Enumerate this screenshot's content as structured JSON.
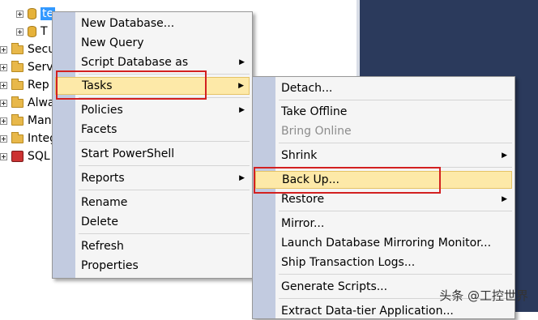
{
  "tree": {
    "nodes": [
      {
        "label": "te",
        "icon": "database-icon"
      },
      {
        "label": "T",
        "icon": "database-icon"
      },
      {
        "label": "Secu",
        "icon": "folder-icon"
      },
      {
        "label": "Serv",
        "icon": "folder-icon"
      },
      {
        "label": "Rep",
        "icon": "folder-icon"
      },
      {
        "label": "Alwa",
        "icon": "folder-icon"
      },
      {
        "label": "Man",
        "icon": "folder-icon"
      },
      {
        "label": "Integ",
        "icon": "folder-icon"
      },
      {
        "label": "SQL",
        "icon": "sql-agent-icon"
      }
    ]
  },
  "context_menu": {
    "items": [
      {
        "label": "New Database..."
      },
      {
        "label": "New Query"
      },
      {
        "label": "Script Database as"
      },
      {
        "label": "Tasks"
      },
      {
        "label": "Policies"
      },
      {
        "label": "Facets"
      },
      {
        "label": "Start PowerShell"
      },
      {
        "label": "Reports"
      },
      {
        "label": "Rename"
      },
      {
        "label": "Delete"
      },
      {
        "label": "Refresh"
      },
      {
        "label": "Properties"
      }
    ]
  },
  "tasks_submenu": {
    "items": [
      {
        "label": "Detach..."
      },
      {
        "label": "Take Offline"
      },
      {
        "label": "Bring Online"
      },
      {
        "label": "Shrink"
      },
      {
        "label": "Back Up..."
      },
      {
        "label": "Restore"
      },
      {
        "label": "Mirror..."
      },
      {
        "label": "Launch Database Mirroring Monitor..."
      },
      {
        "label": "Ship Transaction Logs..."
      },
      {
        "label": "Generate Scripts..."
      },
      {
        "label": "Extract Data-tier Application..."
      }
    ]
  },
  "watermark": "头条 @工控世界",
  "colors": {
    "highlight": "#fde9a8",
    "annotation_box": "#d32020",
    "gutter": "#c2cbe0"
  }
}
